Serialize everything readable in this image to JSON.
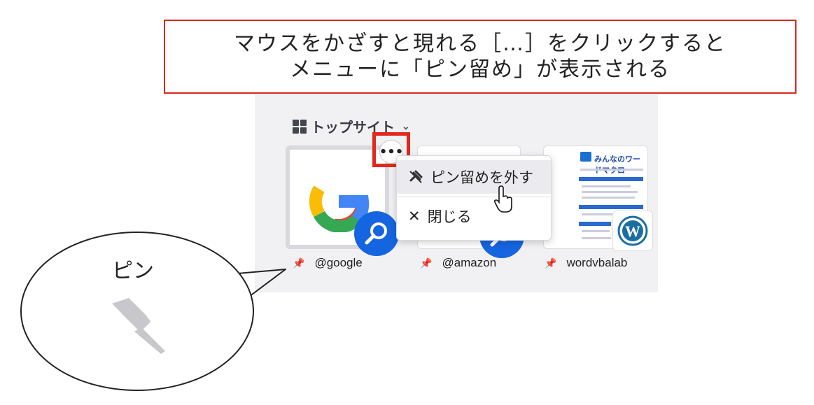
{
  "callout": {
    "line1": "マウスをかざすと現れる［…］をクリックすると",
    "line2": "メニューに「ピン留め」が表示される"
  },
  "section": {
    "title": "トップサイト",
    "chevron": "⌄"
  },
  "tiles": [
    {
      "label": "@google"
    },
    {
      "label": "@amazon"
    },
    {
      "label": "wordvbalab",
      "site_title": "みんなのワードマクロ"
    }
  ],
  "menu": {
    "button": "•••",
    "items": [
      {
        "icon": "unpin-icon",
        "label": "ピン留めを外す"
      },
      {
        "icon": "close-icon",
        "glyph": "✕",
        "label": "閉じる"
      }
    ]
  },
  "bubble": {
    "label": "ピン"
  },
  "colors": {
    "highlight": "#e3271c",
    "search_badge": "#1565e0",
    "panel_bg": "#f1f1f3"
  }
}
